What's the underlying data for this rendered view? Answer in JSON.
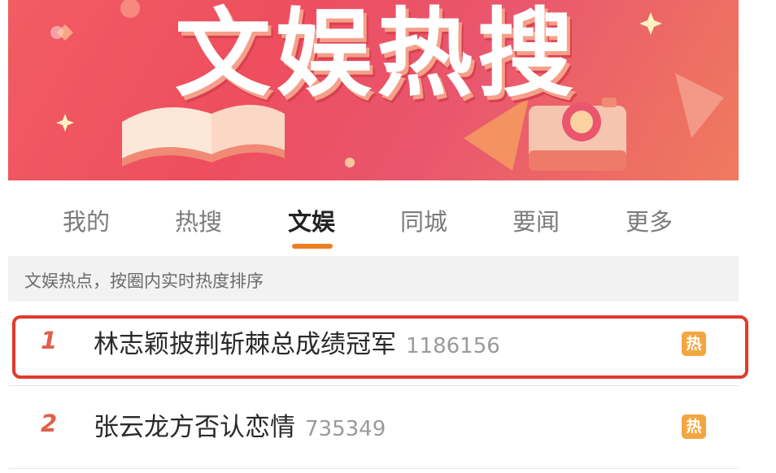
{
  "banner": {
    "title": "文娱热搜"
  },
  "tabs": [
    {
      "label": "我的",
      "active": false
    },
    {
      "label": "热搜",
      "active": false
    },
    {
      "label": "文娱",
      "active": true
    },
    {
      "label": "同城",
      "active": false
    },
    {
      "label": "要闻",
      "active": false
    },
    {
      "label": "更多",
      "active": false
    }
  ],
  "subheader": {
    "text": "文娱热点，按圈内实时热度排序"
  },
  "list": [
    {
      "rank": "1",
      "title": "林志颖披荆斩棘总成绩冠军",
      "count": "1186156",
      "badge": "热",
      "highlighted": true
    },
    {
      "rank": "2",
      "title": "张云龙方否认恋情",
      "count": "735349",
      "badge": "热",
      "highlighted": false
    }
  ],
  "colors": {
    "accent": "#f07d1f",
    "highlight_border": "#e23a2a",
    "badge": "#f3a640",
    "rank": "#e0604a"
  }
}
